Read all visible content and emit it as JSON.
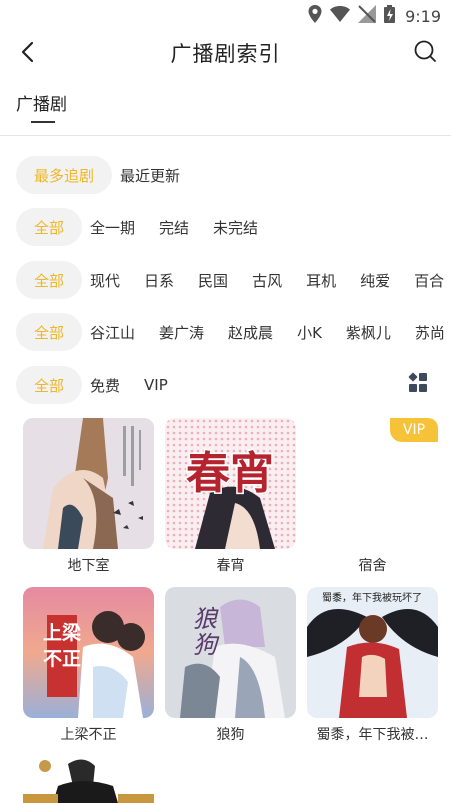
{
  "status_bar": {
    "time": "9:19"
  },
  "header": {
    "title": "广播剧索引"
  },
  "tabs": [
    {
      "label": "广播剧"
    }
  ],
  "filters": {
    "sort": {
      "active": "最多追剧",
      "options": [
        "最近更新"
      ]
    },
    "completion": {
      "active": "全部",
      "options": [
        "全一期",
        "完结",
        "未完结"
      ]
    },
    "genre": {
      "active": "全部",
      "options": [
        "现代",
        "日系",
        "民国",
        "古风",
        "耳机",
        "纯爱",
        "百合"
      ]
    },
    "cv": {
      "active": "全部",
      "options": [
        "谷江山",
        "姜广涛",
        "赵成晨",
        "小K",
        "紫枫儿",
        "苏尚"
      ]
    },
    "price": {
      "active": "全部",
      "options": [
        "免费",
        "VIP"
      ]
    }
  },
  "dramas": [
    {
      "title": "地下室",
      "vip": false
    },
    {
      "title": "春宵",
      "vip": false,
      "cover_text": "春宵"
    },
    {
      "title": "宿舍",
      "vip": true,
      "badge": "VIP"
    },
    {
      "title": "上梁不正",
      "vip": false,
      "cover_text": "上梁不正"
    },
    {
      "title": "狼狗",
      "vip": false,
      "cover_text": "狼狗"
    },
    {
      "title": "蜀黍，年下我被…",
      "vip": false,
      "cover_text": "蜀黍，年下我被玩坏了"
    },
    {
      "title": "",
      "vip": false
    }
  ],
  "colors": {
    "accent": "#f0b626",
    "pill_bg": "#f2f2f2",
    "vip_badge": "#f6c237"
  }
}
